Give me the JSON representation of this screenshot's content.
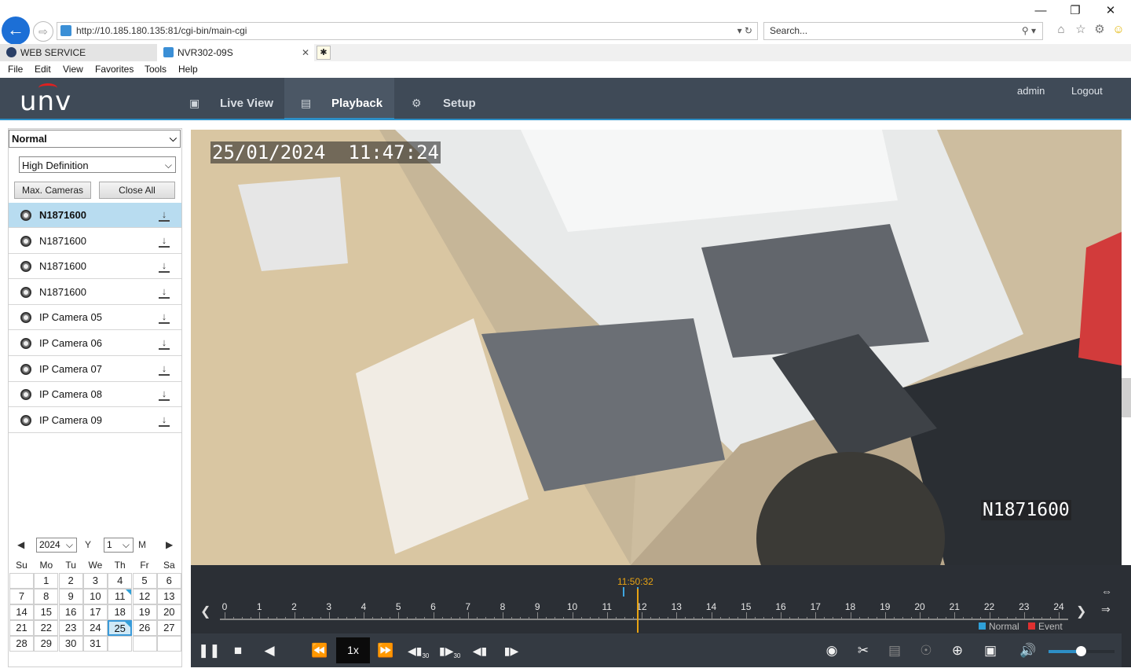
{
  "browser": {
    "url": "http://10.185.180.135:81/cgi-bin/main-cgi",
    "search_placeholder": "Search...",
    "tabs": [
      {
        "label": "WEB SERVICE",
        "active": false
      },
      {
        "label": "NVR302-09S",
        "active": true
      }
    ],
    "menu": [
      "File",
      "Edit",
      "View",
      "Favorites",
      "Tools",
      "Help"
    ]
  },
  "app": {
    "logo": "unv",
    "nav": [
      {
        "label": "Live View",
        "icon": "monitor-icon"
      },
      {
        "label": "Playback",
        "icon": "film-icon",
        "active": true
      },
      {
        "label": "Setup",
        "icon": "gear-icon"
      }
    ],
    "user": "admin",
    "logout": "Logout"
  },
  "left": {
    "mode": "Normal",
    "quality": "High Definition",
    "max_cameras": "Max. Cameras",
    "close_all": "Close All",
    "cameras": [
      {
        "name": "N1871600",
        "active": true
      },
      {
        "name": "N1871600",
        "active": false
      },
      {
        "name": "N1871600",
        "active": false
      },
      {
        "name": "N1871600",
        "active": false
      },
      {
        "name": "IP Camera 05",
        "active": false
      },
      {
        "name": "IP Camera 06",
        "active": false
      },
      {
        "name": "IP Camera 07",
        "active": false
      },
      {
        "name": "IP Camera 08",
        "active": false
      },
      {
        "name": "IP Camera 09",
        "active": false
      }
    ]
  },
  "calendar": {
    "year": "2024",
    "year_unit": "Y",
    "month": "1",
    "month_unit": "M",
    "weekdays": [
      "Su",
      "Mo",
      "Tu",
      "We",
      "Th",
      "Fr",
      "Sa"
    ],
    "days": [
      "",
      "1",
      "2",
      "3",
      "4",
      "5",
      "6",
      "7",
      "8",
      "9",
      "10",
      "11",
      "12",
      "13",
      "14",
      "15",
      "16",
      "17",
      "18",
      "19",
      "20",
      "21",
      "22",
      "23",
      "24",
      "25",
      "26",
      "27",
      "28",
      "29",
      "30",
      "31",
      "",
      "",
      ""
    ],
    "selected": "25",
    "marked": [
      "11",
      "25"
    ]
  },
  "video": {
    "osd_time": "25/01/2024  11:47:24",
    "osd_name": "N1871600"
  },
  "timeline": {
    "current_time": "11:50:32",
    "hours": [
      "0",
      "1",
      "2",
      "3",
      "4",
      "5",
      "6",
      "7",
      "8",
      "9",
      "10",
      "11",
      "12",
      "13",
      "14",
      "15",
      "16",
      "17",
      "18",
      "19",
      "20",
      "21",
      "22",
      "23",
      "24"
    ],
    "legend": [
      {
        "label": "Normal",
        "color": "#2fa0d8"
      },
      {
        "label": "Event",
        "color": "#e03030"
      }
    ]
  },
  "controls": {
    "speed": "1x",
    "skip_back_label": "30",
    "skip_fwd_label": "30",
    "volume_fraction": 0.49
  }
}
